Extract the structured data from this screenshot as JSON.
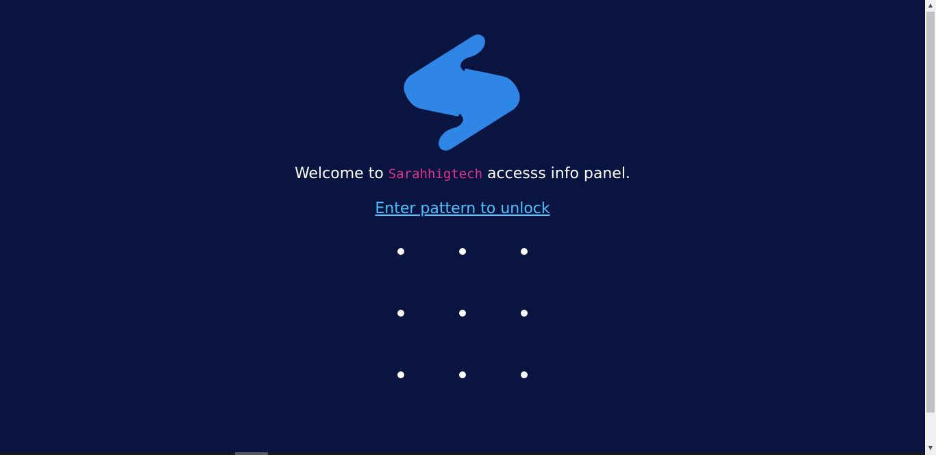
{
  "welcome": {
    "prefix": "Welcome to ",
    "brand": "Sarahhigtech",
    "suffix": " accesss info panel."
  },
  "instruction": {
    "link_text": "Enter pattern to unlock"
  },
  "logo": {
    "icon": "s-logo-icon",
    "color": "#2f86e6"
  },
  "pattern": {
    "rows": 3,
    "cols": 3,
    "dot_color": "#ffffff"
  },
  "colors": {
    "background": "#0a1440",
    "brand": "#e0338a",
    "link": "#4cc3ff"
  }
}
